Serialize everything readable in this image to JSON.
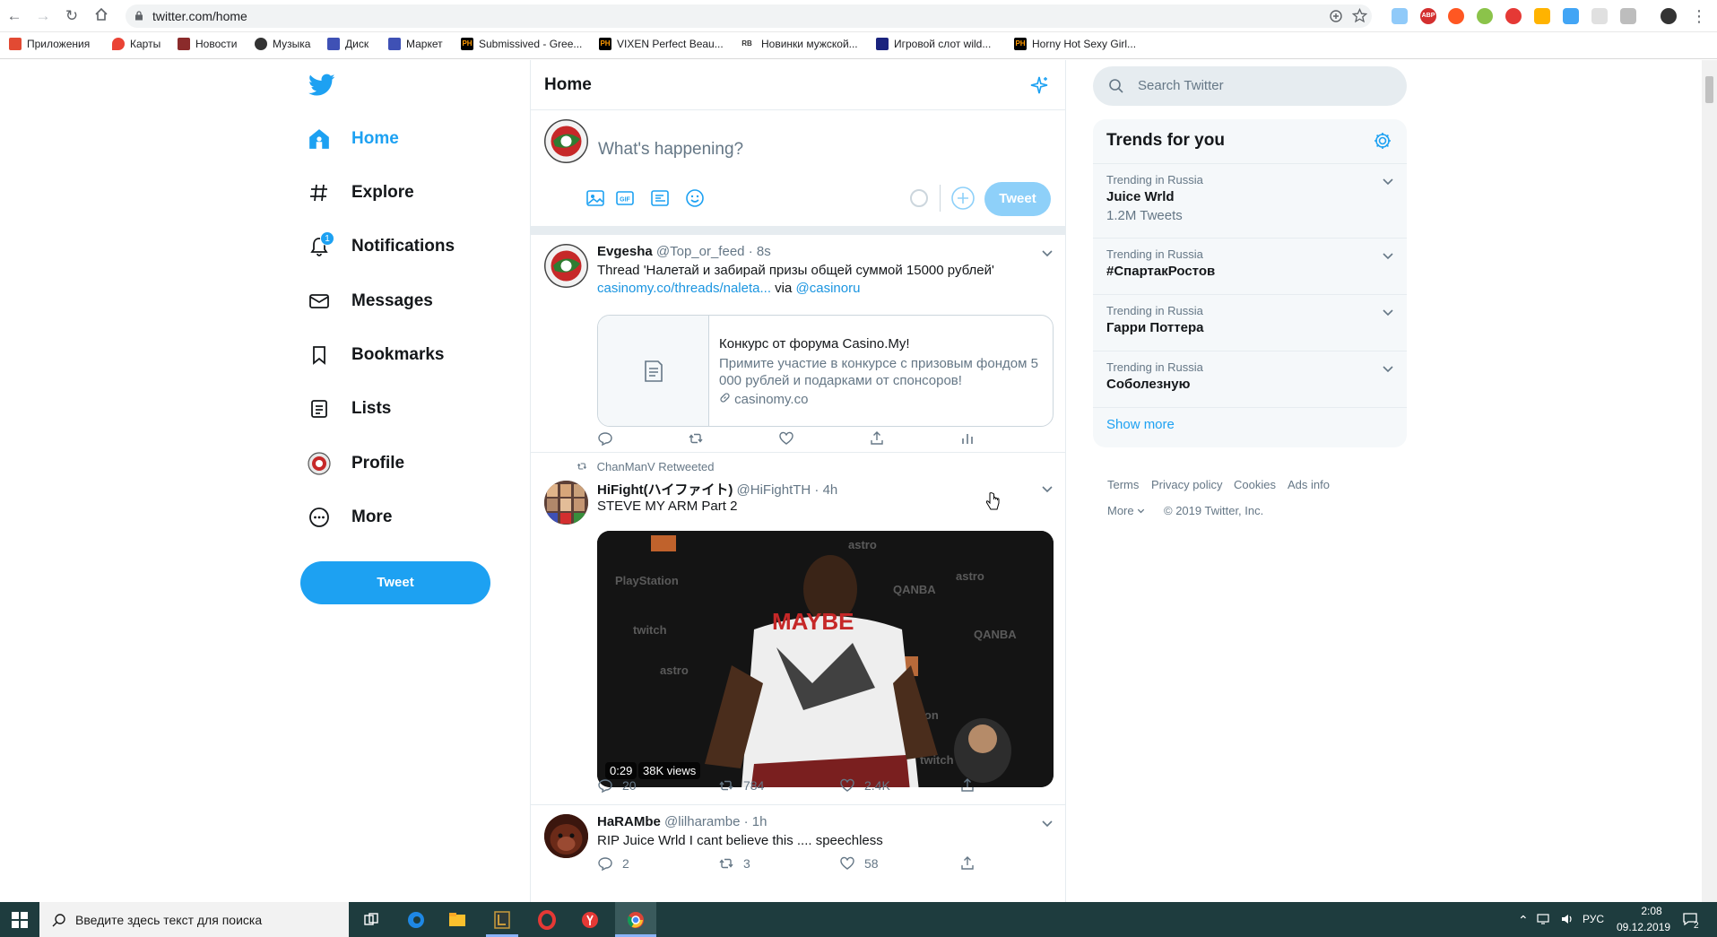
{
  "browser": {
    "url": "twitter.com/home",
    "bookmarks": [
      {
        "label": "Приложения",
        "icon": "apps-grid-icon",
        "color": "#e24a33"
      },
      {
        "label": "Карты",
        "icon": "maps-pin-icon",
        "color": "#ea4335"
      },
      {
        "label": "Новости",
        "icon": "news-icon",
        "color": "#8b2b2b"
      },
      {
        "label": "Музыка",
        "icon": "music-icon",
        "color": "#333333"
      },
      {
        "label": "Диск",
        "icon": "disk-icon",
        "color": "#3f51b5"
      },
      {
        "label": "Маркет",
        "icon": "market-icon",
        "color": "#3f51b5"
      },
      {
        "label": "Submissived - Gree...",
        "icon": "ph-icon",
        "color": "#ff9900"
      },
      {
        "label": "VIXEN Perfect Beau...",
        "icon": "ph-icon",
        "color": "#ff9900"
      },
      {
        "label": "Новинки мужской...",
        "icon": "rb-icon",
        "color": "#333333"
      },
      {
        "label": "Игровой слот wild...",
        "icon": "slot-icon",
        "color": "#1a237e"
      },
      {
        "label": "Horny Hot Sexy Girl...",
        "icon": "ph-icon",
        "color": "#ff9900"
      }
    ]
  },
  "nav": {
    "items": [
      {
        "label": "Home",
        "icon": "home-icon"
      },
      {
        "label": "Explore",
        "icon": "hashtag-icon"
      },
      {
        "label": "Notifications",
        "icon": "bell-icon",
        "badge": "1"
      },
      {
        "label": "Messages",
        "icon": "envelope-icon"
      },
      {
        "label": "Bookmarks",
        "icon": "bookmark-icon"
      },
      {
        "label": "Lists",
        "icon": "list-icon"
      },
      {
        "label": "Profile",
        "icon": "profile-avatar-icon"
      },
      {
        "label": "More",
        "icon": "more-dots-icon"
      }
    ],
    "tweet_button": "Tweet"
  },
  "home": {
    "title": "Home",
    "compose_placeholder": "What's happening?",
    "tweet_button": "Tweet"
  },
  "tweets": [
    {
      "name": "Evgesha",
      "handle": "@Top_or_feed",
      "time": "8s",
      "text": "Thread 'Налетай и забирай призы общей суммой 15000 рублей'",
      "link": "casinomy.co/threads/naleta...",
      "via": "via",
      "mention": "@casinoru",
      "card": {
        "title": "Конкурс от форума Casino.My!",
        "description": "Примите участие в конкурсе с призовым фондом 5 000 рублей и подарками от спонсоров!",
        "domain": "casinomy.co"
      }
    },
    {
      "retweeted_by": "ChanManV Retweeted",
      "name": "HiFight(ハイファイト)",
      "handle": "@HiFightTH",
      "time": "4h",
      "text": "STEVE MY ARM Part 2",
      "video": {
        "duration": "0:29",
        "views": "38K views",
        "shirt_text": "MAYBE"
      },
      "stats": {
        "replies": "20",
        "retweets": "784",
        "likes": "2.4K"
      }
    },
    {
      "name": "HaRAMbe",
      "handle": "@lilharambe",
      "time": "1h",
      "text": "RIP Juice Wrld I cant believe this .... speechless",
      "stats": {
        "replies": "2",
        "retweets": "3",
        "likes": "58"
      }
    }
  ],
  "sidebar": {
    "search_placeholder": "Search Twitter",
    "trends_title": "Trends for you",
    "trends": [
      {
        "context": "Trending in Russia",
        "name": "Juice Wrld",
        "count": "1.2M Tweets"
      },
      {
        "context": "Trending in Russia",
        "name": "#СпартакРостов",
        "count": ""
      },
      {
        "context": "Trending in Russia",
        "name": "Гарри Поттера",
        "count": ""
      },
      {
        "context": "Trending in Russia",
        "name": "Соболезную",
        "count": ""
      }
    ],
    "show_more": "Show more",
    "footer": {
      "terms": "Terms",
      "privacy": "Privacy policy",
      "cookies": "Cookies",
      "ads": "Ads info",
      "more": "More",
      "copyright": "© 2019 Twitter, Inc."
    }
  },
  "taskbar": {
    "search_placeholder": "Введите здесь текст для поиска",
    "lang": "РУС",
    "time": "2:08",
    "date": "09.12.2019",
    "notifications": "2"
  },
  "colors": {
    "accent": "#1da1f2",
    "taskbar": "#1e3c3e"
  }
}
